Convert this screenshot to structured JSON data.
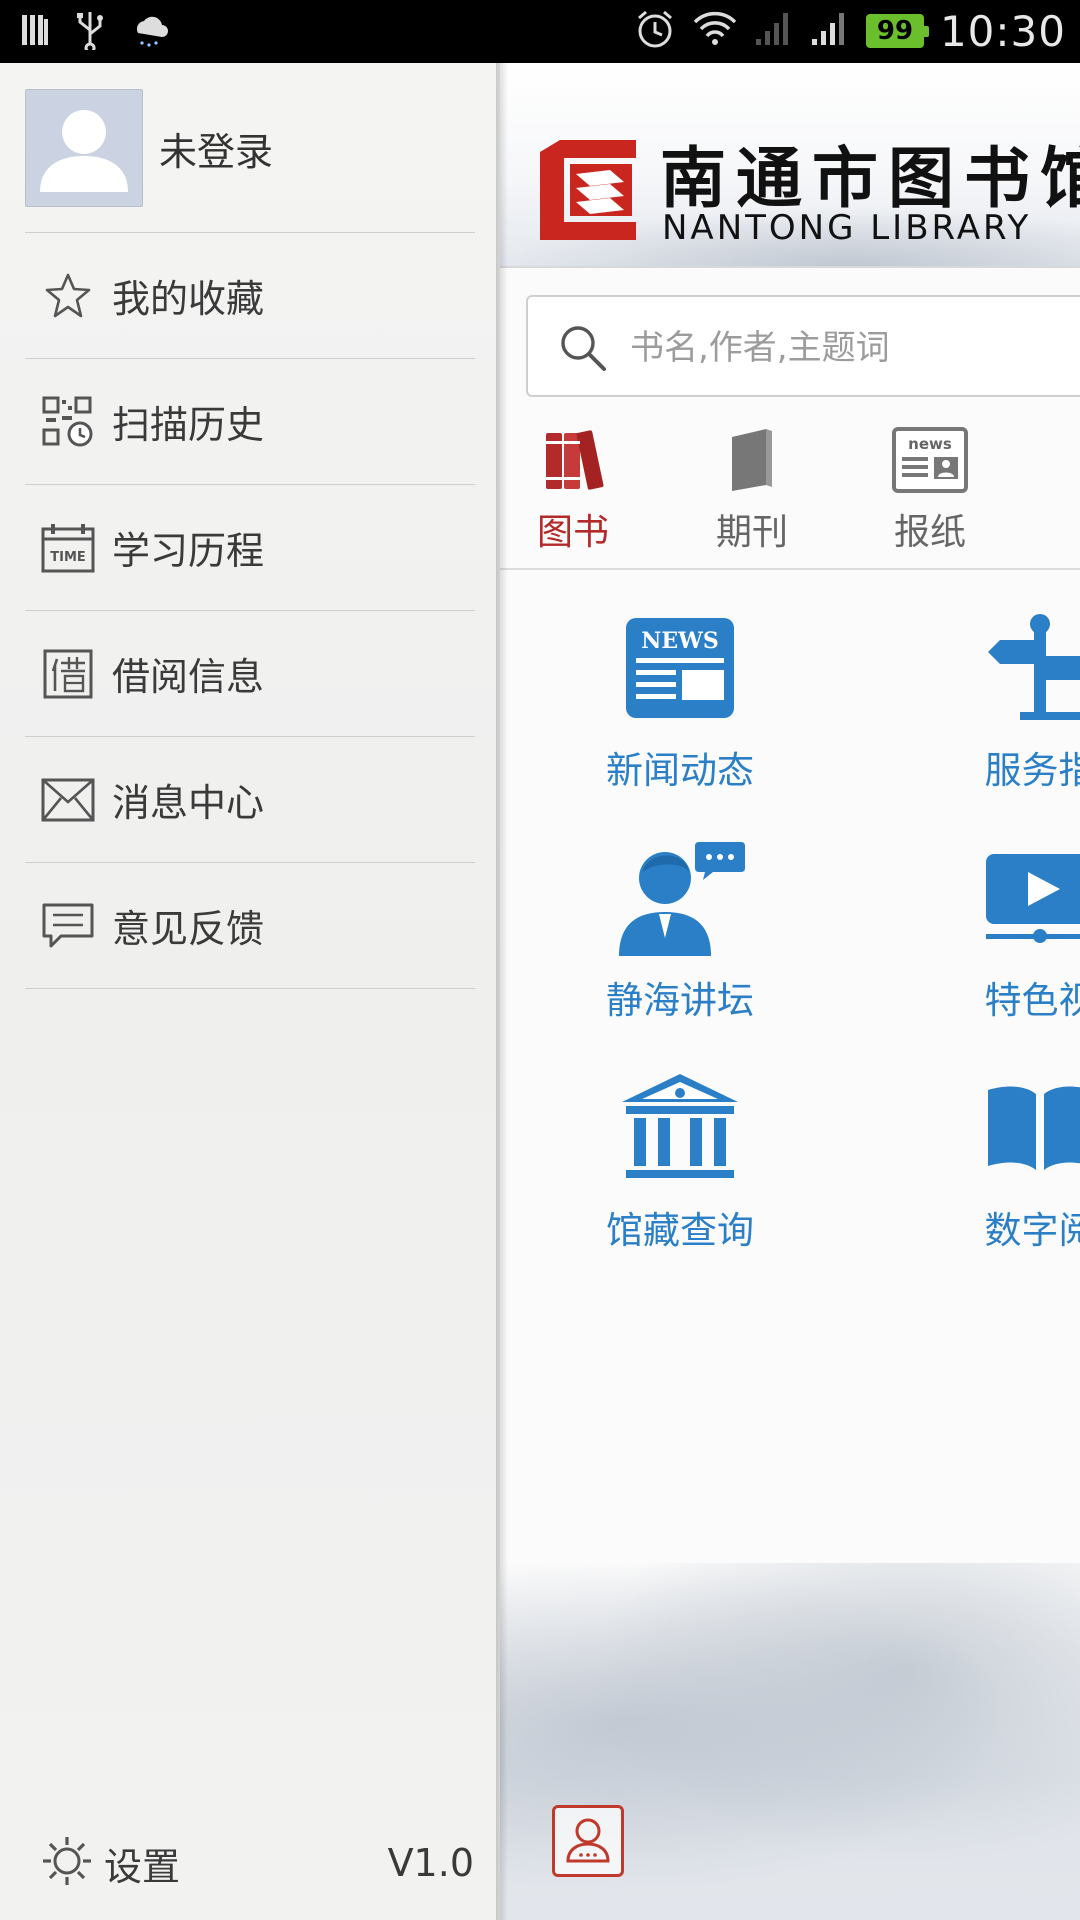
{
  "status_bar": {
    "time": "10:30",
    "battery": "99",
    "icons": [
      "sim-icon",
      "usb-icon",
      "weather-icon",
      "alarm-icon",
      "wifi-icon",
      "signal-icon"
    ]
  },
  "drawer": {
    "login_label": "未登录",
    "menu": [
      {
        "label": "我的收藏",
        "icon": "star-icon"
      },
      {
        "label": "扫描历史",
        "icon": "qr-history-icon"
      },
      {
        "label": "学习历程",
        "icon": "time-calendar-icon"
      },
      {
        "label": "借阅信息",
        "icon": "borrow-icon"
      },
      {
        "label": "消息中心",
        "icon": "envelope-icon"
      },
      {
        "label": "意见反馈",
        "icon": "feedback-icon"
      }
    ],
    "settings_label": "设置",
    "version": "V1.0"
  },
  "main": {
    "logo_cn": "南通市图书馆",
    "logo_en": "NANTONG LIBRARY",
    "search_placeholder": "书名,作者,主题词",
    "tabs": [
      {
        "label": "图书",
        "active": true
      },
      {
        "label": "期刊",
        "active": false
      },
      {
        "label": "报纸",
        "active": false
      }
    ],
    "grid": [
      {
        "label": "新闻动态",
        "icon": "news-icon"
      },
      {
        "label": "服务指",
        "icon": "signpost-icon"
      },
      {
        "label": "静海讲坛",
        "icon": "speaker-icon"
      },
      {
        "label": "特色视",
        "icon": "video-icon"
      },
      {
        "label": "馆藏查询",
        "icon": "museum-icon"
      },
      {
        "label": "数字阅",
        "icon": "book-icon"
      }
    ],
    "news_icon_text": "NEWS",
    "newspaper_icon_text": "news"
  },
  "colors": {
    "accent_red": "#b32a2a",
    "link_blue": "#2a7fc7",
    "battery_green": "#6bbf2c"
  }
}
